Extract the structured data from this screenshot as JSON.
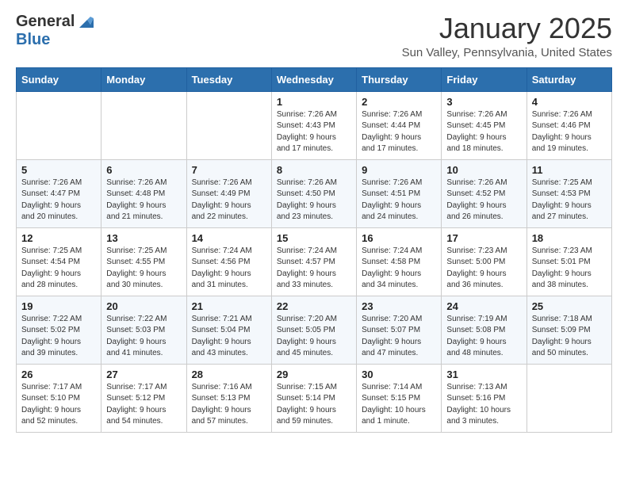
{
  "logo": {
    "general": "General",
    "blue": "Blue"
  },
  "title": "January 2025",
  "subtitle": "Sun Valley, Pennsylvania, United States",
  "weekdays": [
    "Sunday",
    "Monday",
    "Tuesday",
    "Wednesday",
    "Thursday",
    "Friday",
    "Saturday"
  ],
  "weeks": [
    [
      {
        "day": "",
        "info": ""
      },
      {
        "day": "",
        "info": ""
      },
      {
        "day": "",
        "info": ""
      },
      {
        "day": "1",
        "info": "Sunrise: 7:26 AM\nSunset: 4:43 PM\nDaylight: 9 hours\nand 17 minutes."
      },
      {
        "day": "2",
        "info": "Sunrise: 7:26 AM\nSunset: 4:44 PM\nDaylight: 9 hours\nand 17 minutes."
      },
      {
        "day": "3",
        "info": "Sunrise: 7:26 AM\nSunset: 4:45 PM\nDaylight: 9 hours\nand 18 minutes."
      },
      {
        "day": "4",
        "info": "Sunrise: 7:26 AM\nSunset: 4:46 PM\nDaylight: 9 hours\nand 19 minutes."
      }
    ],
    [
      {
        "day": "5",
        "info": "Sunrise: 7:26 AM\nSunset: 4:47 PM\nDaylight: 9 hours\nand 20 minutes."
      },
      {
        "day": "6",
        "info": "Sunrise: 7:26 AM\nSunset: 4:48 PM\nDaylight: 9 hours\nand 21 minutes."
      },
      {
        "day": "7",
        "info": "Sunrise: 7:26 AM\nSunset: 4:49 PM\nDaylight: 9 hours\nand 22 minutes."
      },
      {
        "day": "8",
        "info": "Sunrise: 7:26 AM\nSunset: 4:50 PM\nDaylight: 9 hours\nand 23 minutes."
      },
      {
        "day": "9",
        "info": "Sunrise: 7:26 AM\nSunset: 4:51 PM\nDaylight: 9 hours\nand 24 minutes."
      },
      {
        "day": "10",
        "info": "Sunrise: 7:26 AM\nSunset: 4:52 PM\nDaylight: 9 hours\nand 26 minutes."
      },
      {
        "day": "11",
        "info": "Sunrise: 7:25 AM\nSunset: 4:53 PM\nDaylight: 9 hours\nand 27 minutes."
      }
    ],
    [
      {
        "day": "12",
        "info": "Sunrise: 7:25 AM\nSunset: 4:54 PM\nDaylight: 9 hours\nand 28 minutes."
      },
      {
        "day": "13",
        "info": "Sunrise: 7:25 AM\nSunset: 4:55 PM\nDaylight: 9 hours\nand 30 minutes."
      },
      {
        "day": "14",
        "info": "Sunrise: 7:24 AM\nSunset: 4:56 PM\nDaylight: 9 hours\nand 31 minutes."
      },
      {
        "day": "15",
        "info": "Sunrise: 7:24 AM\nSunset: 4:57 PM\nDaylight: 9 hours\nand 33 minutes."
      },
      {
        "day": "16",
        "info": "Sunrise: 7:24 AM\nSunset: 4:58 PM\nDaylight: 9 hours\nand 34 minutes."
      },
      {
        "day": "17",
        "info": "Sunrise: 7:23 AM\nSunset: 5:00 PM\nDaylight: 9 hours\nand 36 minutes."
      },
      {
        "day": "18",
        "info": "Sunrise: 7:23 AM\nSunset: 5:01 PM\nDaylight: 9 hours\nand 38 minutes."
      }
    ],
    [
      {
        "day": "19",
        "info": "Sunrise: 7:22 AM\nSunset: 5:02 PM\nDaylight: 9 hours\nand 39 minutes."
      },
      {
        "day": "20",
        "info": "Sunrise: 7:22 AM\nSunset: 5:03 PM\nDaylight: 9 hours\nand 41 minutes."
      },
      {
        "day": "21",
        "info": "Sunrise: 7:21 AM\nSunset: 5:04 PM\nDaylight: 9 hours\nand 43 minutes."
      },
      {
        "day": "22",
        "info": "Sunrise: 7:20 AM\nSunset: 5:05 PM\nDaylight: 9 hours\nand 45 minutes."
      },
      {
        "day": "23",
        "info": "Sunrise: 7:20 AM\nSunset: 5:07 PM\nDaylight: 9 hours\nand 47 minutes."
      },
      {
        "day": "24",
        "info": "Sunrise: 7:19 AM\nSunset: 5:08 PM\nDaylight: 9 hours\nand 48 minutes."
      },
      {
        "day": "25",
        "info": "Sunrise: 7:18 AM\nSunset: 5:09 PM\nDaylight: 9 hours\nand 50 minutes."
      }
    ],
    [
      {
        "day": "26",
        "info": "Sunrise: 7:17 AM\nSunset: 5:10 PM\nDaylight: 9 hours\nand 52 minutes."
      },
      {
        "day": "27",
        "info": "Sunrise: 7:17 AM\nSunset: 5:12 PM\nDaylight: 9 hours\nand 54 minutes."
      },
      {
        "day": "28",
        "info": "Sunrise: 7:16 AM\nSunset: 5:13 PM\nDaylight: 9 hours\nand 57 minutes."
      },
      {
        "day": "29",
        "info": "Sunrise: 7:15 AM\nSunset: 5:14 PM\nDaylight: 9 hours\nand 59 minutes."
      },
      {
        "day": "30",
        "info": "Sunrise: 7:14 AM\nSunset: 5:15 PM\nDaylight: 10 hours\nand 1 minute."
      },
      {
        "day": "31",
        "info": "Sunrise: 7:13 AM\nSunset: 5:16 PM\nDaylight: 10 hours\nand 3 minutes."
      },
      {
        "day": "",
        "info": ""
      }
    ]
  ]
}
